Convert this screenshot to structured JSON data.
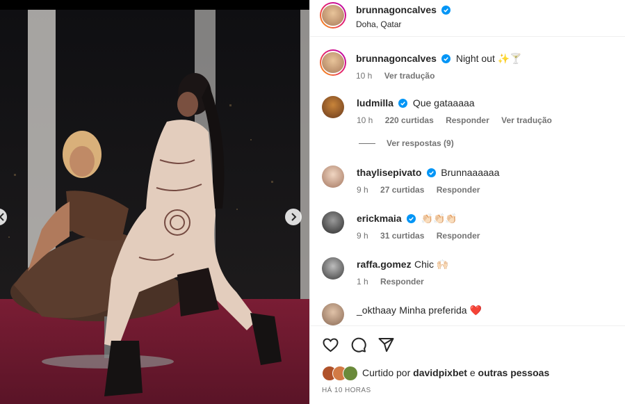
{
  "post_header": {
    "username": "brunnagoncalves",
    "location": "Doha, Qatar"
  },
  "caption": {
    "username": "brunnagoncalves",
    "text": "Night out ✨🍸",
    "time": "10 h",
    "translate": "Ver tradução"
  },
  "comments": [
    {
      "username": "ludmilla",
      "verified": true,
      "text": "Que gataaaaa",
      "time": "10 h",
      "likes": "220 curtidas",
      "reply": "Responder",
      "translate": "Ver tradução",
      "view_replies": "Ver respostas (9)"
    },
    {
      "username": "thaylisepivato",
      "verified": true,
      "text": "Brunnaaaaaa",
      "time": "9 h",
      "likes": "27 curtidas",
      "reply": "Responder"
    },
    {
      "username": "erickmaia",
      "verified": true,
      "text": "👏🏻👏🏻👏🏻",
      "time": "9 h",
      "likes": "31 curtidas",
      "reply": "Responder"
    },
    {
      "username": "raffa.gomez",
      "verified": false,
      "text": "Chic 🙌🏻",
      "time": "1 h",
      "reply": "Responder"
    },
    {
      "username": "_okthaay",
      "verified": false,
      "text": "Minha preferida ❤️"
    }
  ],
  "liked_by": {
    "prefix": "Curtido por",
    "user": "davidpixbet",
    "connector": "e",
    "others": "outras pessoas"
  },
  "post_time": "HÁ 10 HORAS",
  "icons": [
    "heart-icon",
    "comment-icon",
    "share-icon",
    "verified-icon",
    "chevron-right-icon",
    "chevron-left-icon"
  ],
  "colors": {
    "verified": "#0095f6",
    "muted": "#737373",
    "text": "#262626"
  }
}
